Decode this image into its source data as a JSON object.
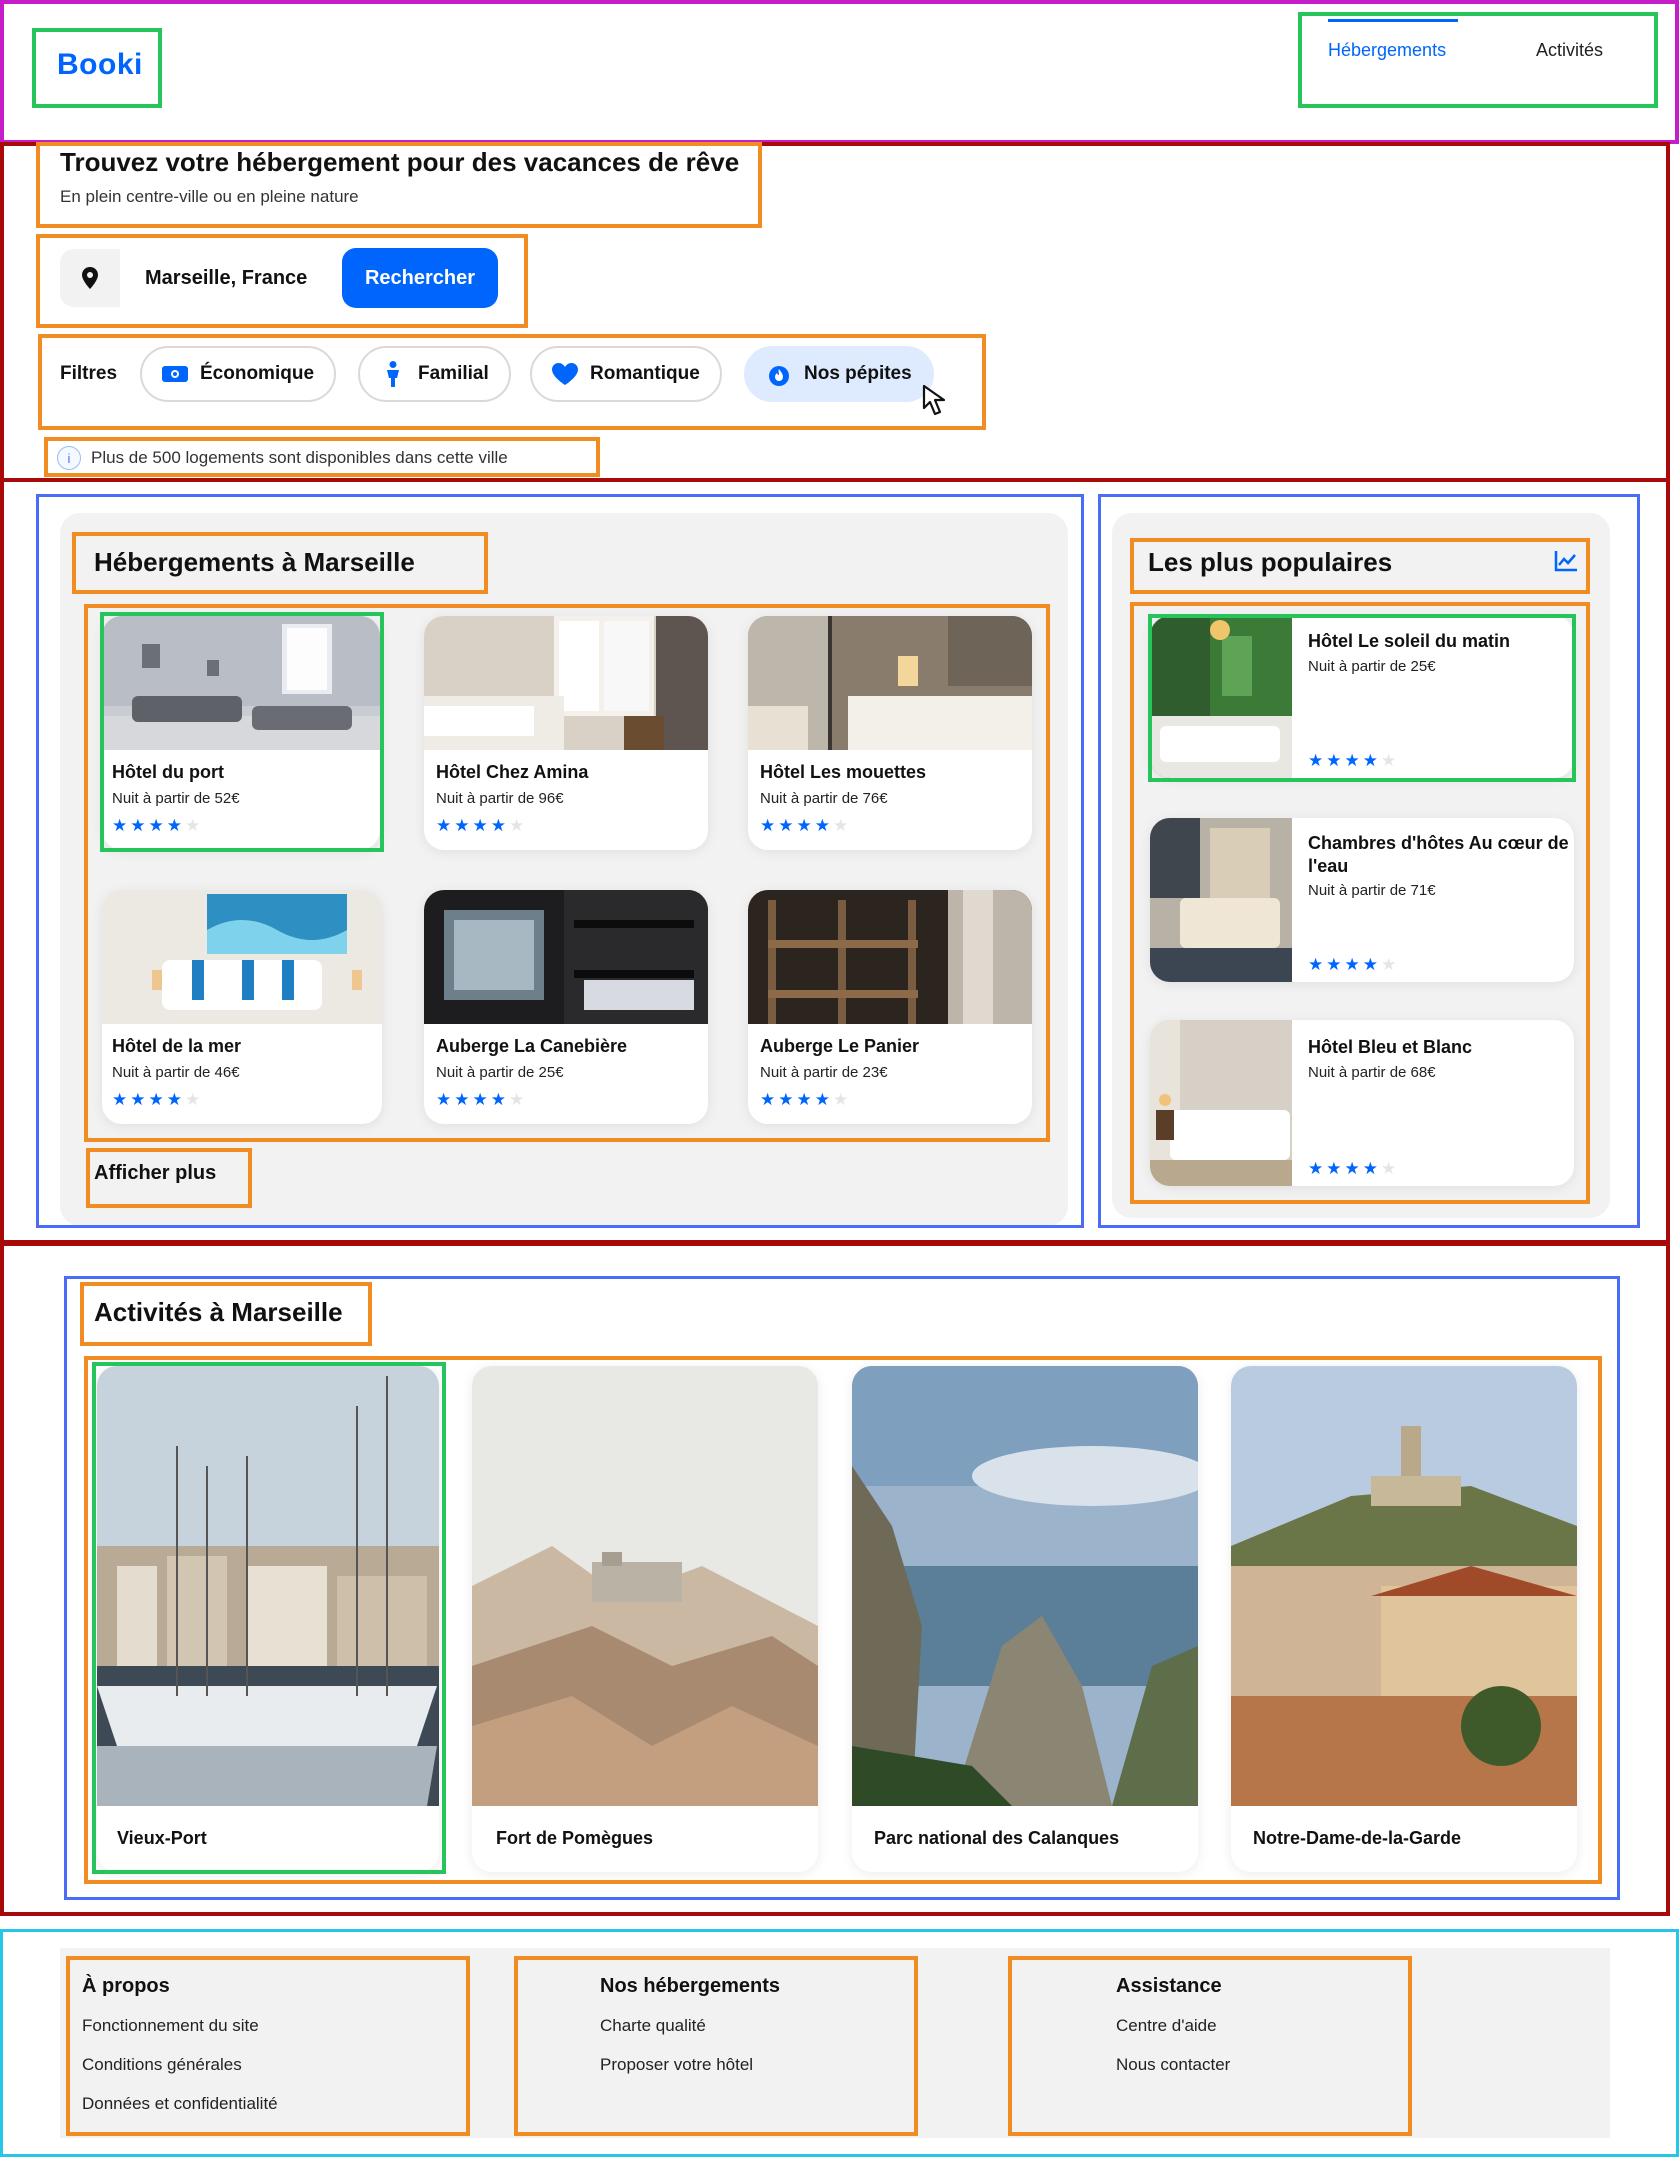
{
  "header": {
    "logo": "Booki",
    "nav": [
      {
        "label": "Hébergements",
        "active": true
      },
      {
        "label": "Activités",
        "active": false
      }
    ]
  },
  "hero": {
    "title": "Trouvez votre hébergement pour des vacances de rêve",
    "subtitle": "En plein centre-ville ou en pleine nature"
  },
  "search": {
    "icon": "location-pin-icon",
    "value": "Marseille, France",
    "button_label": "Rechercher"
  },
  "filters": {
    "label": "Filtres",
    "items": [
      {
        "label": "Économique",
        "icon": "money-icon",
        "selected": false
      },
      {
        "label": "Familial",
        "icon": "person-icon",
        "selected": false
      },
      {
        "label": "Romantique",
        "icon": "heart-icon",
        "selected": false
      },
      {
        "label": "Nos pépites",
        "icon": "flame-icon",
        "selected": true
      }
    ]
  },
  "info": {
    "text": "Plus de 500 logements sont disponibles dans cette ville"
  },
  "accommodations": {
    "title": "Hébergements à Marseille",
    "more_label": "Afficher plus",
    "items": [
      {
        "name": "Hôtel du port",
        "price": "Nuit à partir de 52€",
        "rating": 4
      },
      {
        "name": "Hôtel Chez Amina",
        "price": "Nuit à partir de 96€",
        "rating": 4
      },
      {
        "name": "Hôtel Les mouettes",
        "price": "Nuit à partir de 76€",
        "rating": 4
      },
      {
        "name": "Hôtel de la mer",
        "price": "Nuit à partir de 46€",
        "rating": 4
      },
      {
        "name": "Auberge La Canebière",
        "price": "Nuit à partir de 25€",
        "rating": 4
      },
      {
        "name": "Auberge Le Panier",
        "price": "Nuit à partir de 23€",
        "rating": 4
      }
    ]
  },
  "popular": {
    "title": "Les plus populaires",
    "icon": "trending-chart-icon",
    "items": [
      {
        "name": "Hôtel Le soleil du matin",
        "price": "Nuit à partir de 25€",
        "rating": 4
      },
      {
        "name": "Chambres d'hôtes Au cœur de l'eau",
        "price": "Nuit à partir de 71€",
        "rating": 4
      },
      {
        "name": "Hôtel Bleu et Blanc",
        "price": "Nuit à partir de 68€",
        "rating": 4
      }
    ]
  },
  "activities": {
    "title": "Activités à Marseille",
    "items": [
      {
        "name": "Vieux-Port"
      },
      {
        "name": "Fort de Pomègues"
      },
      {
        "name": "Parc national des Calanques"
      },
      {
        "name": "Notre-Dame-de-la-Garde"
      }
    ]
  },
  "footer": {
    "columns": [
      {
        "title": "À propos",
        "links": [
          "Fonctionnement du site",
          "Conditions générales",
          "Données et confidentialité"
        ]
      },
      {
        "title": "Nos hébergements",
        "links": [
          "Charte qualité",
          "Proposer votre hôtel"
        ]
      },
      {
        "title": "Assistance",
        "links": [
          "Centre d'aide",
          "Nous contacter"
        ]
      }
    ]
  },
  "colors": {
    "brand": "#0065fc",
    "chip_selected": "#deebff",
    "panel": "#f2f2f2"
  }
}
